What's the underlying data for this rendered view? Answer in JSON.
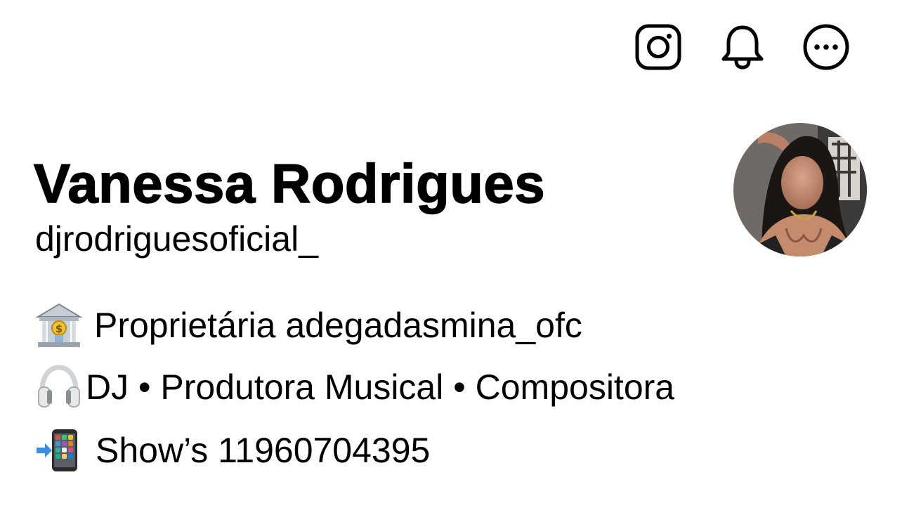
{
  "topbar": {
    "icons": [
      "instagram-icon",
      "bell-icon",
      "more-icon"
    ]
  },
  "profile": {
    "display_name": "Vanessa Rodrigues",
    "username": "djrodriguesoficial_"
  },
  "bio": [
    {
      "icon": "bank-emoji-icon",
      "text": "Proprietária adegadasmina_ofc"
    },
    {
      "icon": "headphones-emoji-icon",
      "text": "DJ • Produtora Musical • Compositora"
    },
    {
      "icon": "phone-arrow-emoji-icon",
      "text": "Show’s 11960704395"
    }
  ],
  "colors": {
    "text": "#000000",
    "background": "#ffffff"
  }
}
